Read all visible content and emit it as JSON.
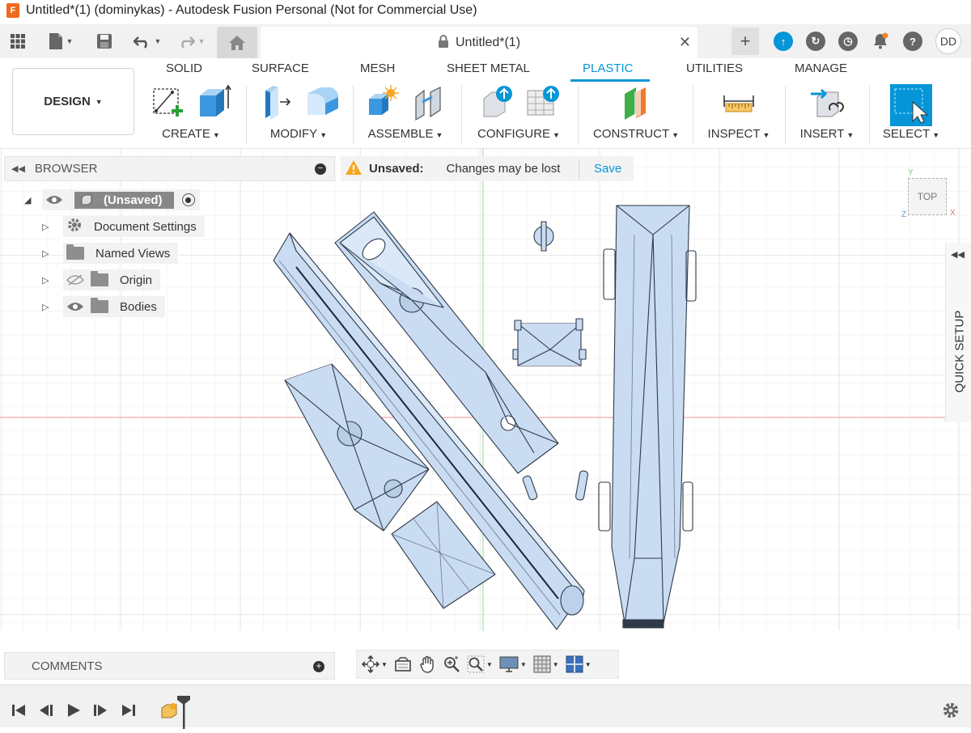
{
  "window": {
    "title": "Untitled*(1) (dominykas) - Autodesk Fusion Personal (Not for Commercial Use)",
    "logo_letter": "F"
  },
  "document_tab": {
    "title": "Untitled*(1)"
  },
  "user": {
    "initials": "DD"
  },
  "ribbon": {
    "workspace": "DESIGN",
    "tabs": [
      "SOLID",
      "SURFACE",
      "MESH",
      "SHEET METAL",
      "PLASTIC",
      "UTILITIES",
      "MANAGE"
    ],
    "active_tab": "PLASTIC",
    "groups": {
      "create": "CREATE",
      "modify": "MODIFY",
      "assemble": "ASSEMBLE",
      "configure": "CONFIGURE",
      "construct": "CONSTRUCT",
      "inspect": "INSPECT",
      "insert": "INSERT",
      "select": "SELECT"
    }
  },
  "browser": {
    "title": "BROWSER",
    "root": "(Unsaved)",
    "items": [
      "Document Settings",
      "Named Views",
      "Origin",
      "Bodies"
    ]
  },
  "notice": {
    "title": "Unsaved:",
    "message": "Changes may be lost",
    "action": "Save"
  },
  "viewcube": {
    "face": "TOP",
    "axis_x": "X",
    "axis_y": "Y",
    "axis_z": "Z"
  },
  "quick_setup": {
    "label": "QUICK SETUP"
  },
  "comments": {
    "label": "COMMENTS"
  },
  "colors": {
    "accent": "#0696d7",
    "body_fill": "#c9dcf2",
    "body_edge": "#2e3a48",
    "grid": "#e6e6e6",
    "x_axis": "#ef9a9a",
    "y_axis": "#a5d6a7"
  }
}
